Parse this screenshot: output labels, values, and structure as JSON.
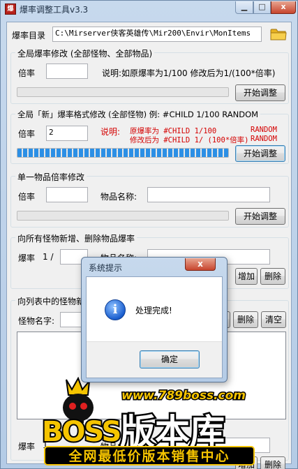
{
  "window": {
    "title": "爆率调整工具v3.3",
    "icon_text": "爆"
  },
  "rate_dir": {
    "label": "爆率目录",
    "path": "C:\\Mirserver侠客英雄传\\Mir200\\Envir\\MonItems"
  },
  "global": {
    "title": "全局爆率修改 (全部怪物、全部物品)",
    "rate_label": "倍率",
    "rate_value": "",
    "note": "说明:如原爆率为1/100 修改后为1/(100*倍率)",
    "button": "开始调整",
    "progress": 0
  },
  "new_format": {
    "title": "全局「新」爆率格式修改 (全部怪物) 例: #CHILD 1/100 RANDOM",
    "rate_label": "倍率",
    "rate_value": "2",
    "note_label": "说明:",
    "line1_a": "原爆率为 #CHILD 1/100",
    "line1_b": "RANDOM",
    "line2_a": "修改后为 #CHILD 1/ (100*倍率)",
    "line2_b": "RANDOM",
    "button": "开始调整",
    "progress": 1.0
  },
  "single_item": {
    "title": "单一物品倍率修改",
    "rate_label": "倍率",
    "rate_value": "",
    "name_label": "物品名称:",
    "name_value": "",
    "button": "开始调整",
    "progress": 0
  },
  "add_all": {
    "title": "向所有怪物新增、删除物品爆率",
    "rate_label": "爆率",
    "rate_prefix": "1 /",
    "rate_value": "",
    "name_label": "物品名称:",
    "name_value": "",
    "add_button": "增加",
    "delete_button": "删除"
  },
  "list_monsters": {
    "title_partial": "向列表中的怪物新",
    "monster_label": "怪物名字:",
    "add_button": "增加",
    "delete_button": "删除",
    "clear_button": "清空",
    "rate_label": "爆率",
    "rate_prefix": "1",
    "name_label": "物品名",
    "bottom_add": "增加",
    "bottom_delete": "删除"
  },
  "dialog": {
    "title": "系统提示",
    "message": "处理完成!",
    "ok_button": "确定",
    "close_glyph": "x"
  },
  "watermark": {
    "url": "www.789boss.com",
    "brand_latin": "BOSS",
    "brand_cn": "版本库",
    "tagline": "全网最低价版本销售中心"
  },
  "colors": {
    "accent_blue": "#2c8fe5",
    "note_red": "#d40000",
    "watermark_gold": "#f5c400"
  }
}
